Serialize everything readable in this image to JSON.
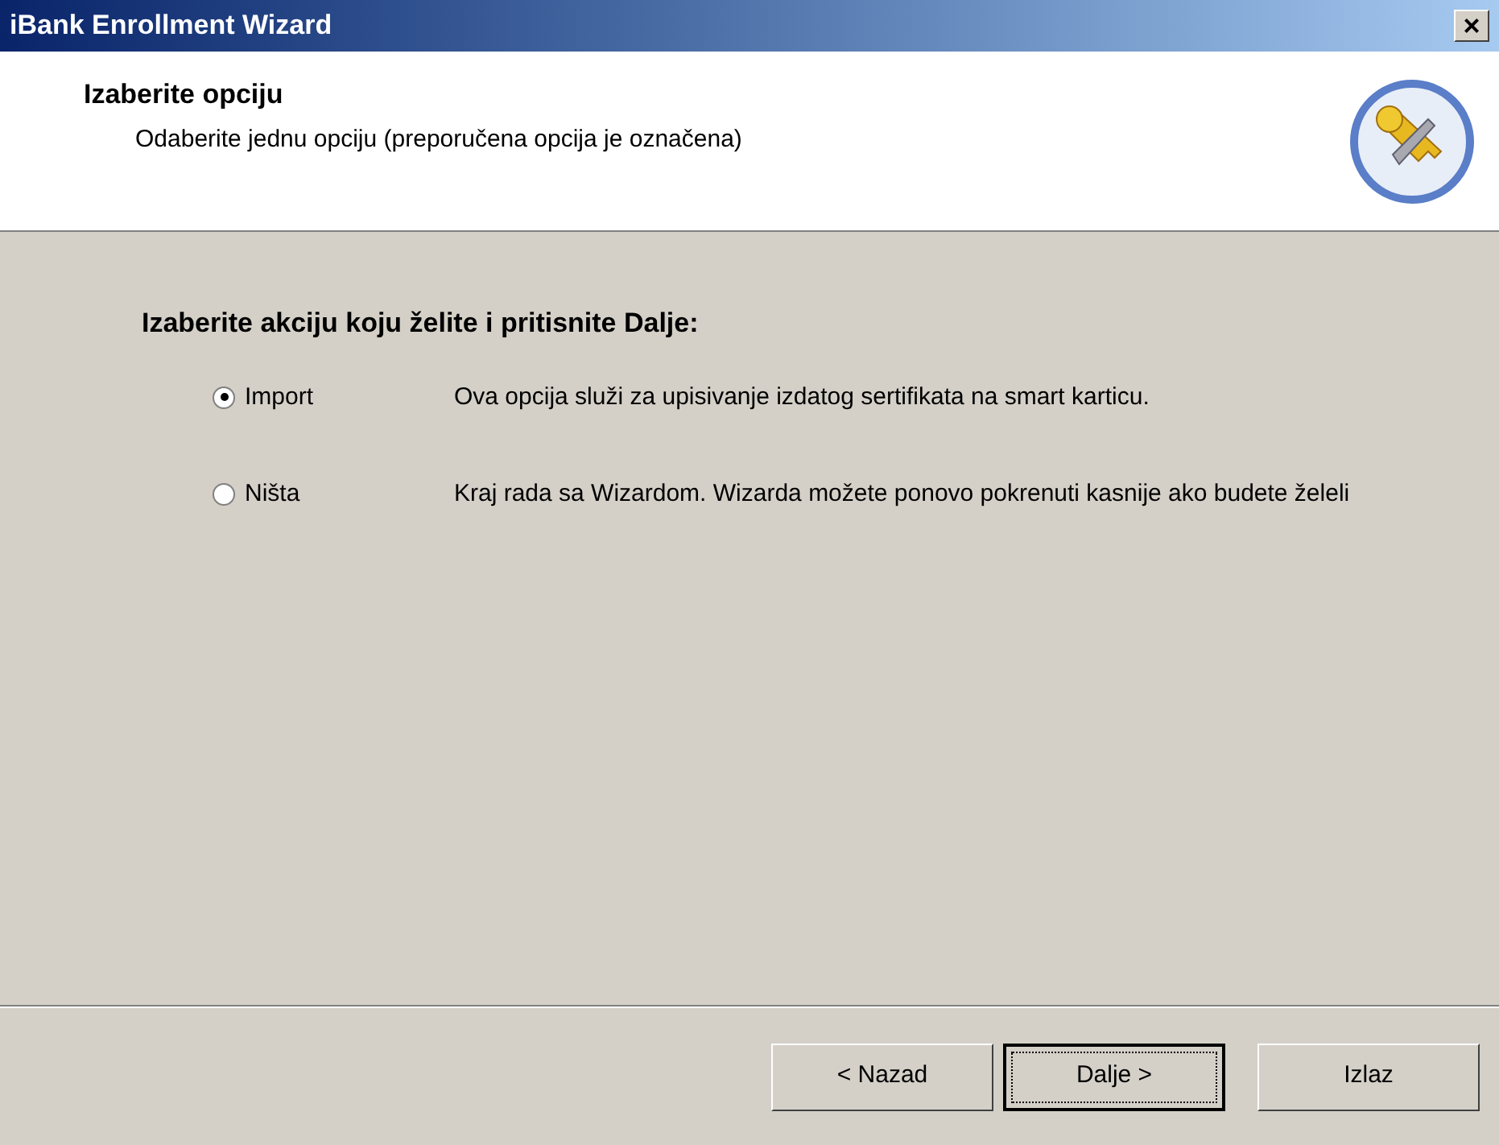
{
  "window": {
    "title": "iBank Enrollment Wizard",
    "close": "×"
  },
  "header": {
    "title": "Izaberite opciju",
    "subtitle": "Odaberite jednu opciju (preporučena opcija je označena)"
  },
  "prompt": "Izaberite akciju koju želite i pritisnite Dalje:",
  "options": [
    {
      "label": "Import",
      "description": "Ova opcija služi za upisivanje izdatog sertifikata na smart karticu.",
      "selected": true
    },
    {
      "label": "Ništa",
      "description": "Kraj rada sa Wizardom. Wizarda možete ponovo pokrenuti kasnije ako budete želeli",
      "selected": false
    }
  ],
  "buttons": [
    {
      "label": "< Nazad",
      "default": false
    },
    {
      "label": "Dalje >",
      "default": true
    },
    {
      "label": "Izlaz",
      "default": false
    }
  ]
}
